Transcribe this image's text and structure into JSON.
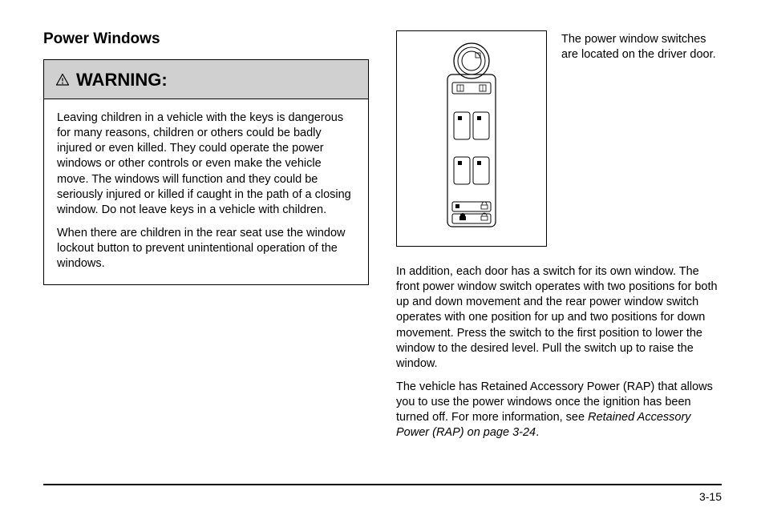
{
  "section_title": "Power Windows",
  "warning": {
    "label": "WARNING:",
    "para1": "Leaving children in a vehicle with the keys is dangerous for many reasons, children or others could be badly injured or even killed. They could operate the power windows or other controls or even make the vehicle move. The windows will function and they could be seriously injured or killed if caught in the path of a closing window. Do not leave keys in a vehicle with children.",
    "para2": "When there are children in the rear seat use the window lockout button to prevent unintentional operation of the windows."
  },
  "intro_side": "The power window switches are located on the driver door.",
  "body": {
    "p1": "In addition, each door has a switch for its own window. The front power window switch operates with two positions for both up and down movement and the rear power window switch operates with one position for up and two positions for down movement. Press the switch to the first position to lower the window to the desired level. Pull the switch up to raise the window.",
    "p2a": "The vehicle has Retained Accessory Power (RAP) that allows you to use the power windows once the ignition has been turned off. For more information, see ",
    "p2b_italic": "Retained Accessory Power (RAP) on page 3-24",
    "p2c": "."
  },
  "page_number": "3-15"
}
